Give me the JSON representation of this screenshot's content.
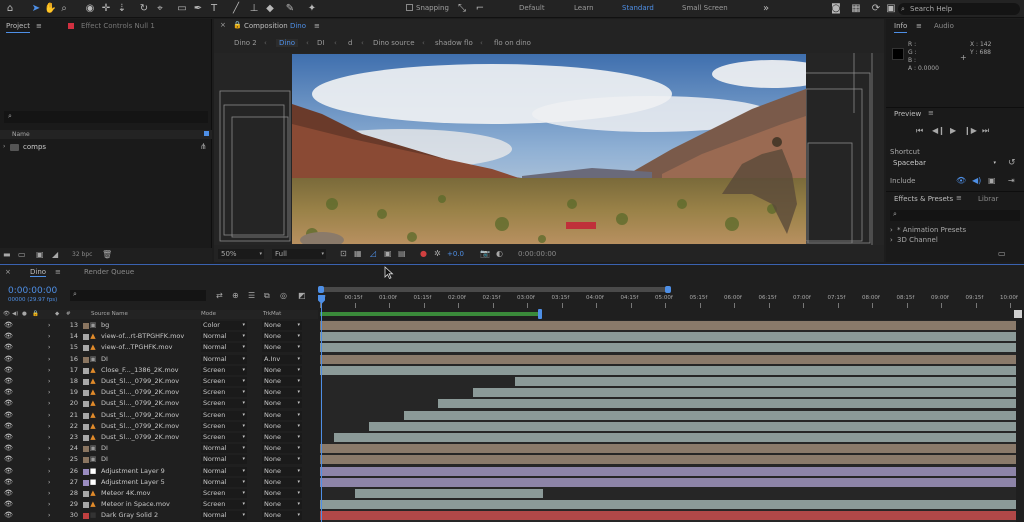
{
  "toolbar": {
    "snapping_label": "Snapping",
    "workspaces": [
      "Default",
      "Learn",
      "Standard",
      "Small Screen"
    ],
    "active_workspace": "Standard",
    "search_placeholder": "Search Help"
  },
  "project_panel": {
    "tab_project": "Project",
    "tab_effect_controls": "Effect Controls Null 1",
    "name_column": "Name",
    "folder": "comps",
    "bpc": "32 bpc"
  },
  "composition_panel": {
    "title_prefix": "Composition",
    "title_name": "Dino",
    "breadcrumbs": [
      "Dino 2",
      "Dino",
      "DI",
      "d",
      "Dino source",
      "shadow flo",
      "flo on dino"
    ],
    "zoom": "50%",
    "resolution": "Full",
    "exposure": "+0.0",
    "timecode": "0:00:00:00"
  },
  "info_panel": {
    "tab_info": "Info",
    "tab_audio": "Audio",
    "r": "R :",
    "g": "G :",
    "b": "B :",
    "a": "A : 0.0000",
    "x": "X : 142",
    "y": "Y : 688"
  },
  "preview_panel": {
    "title": "Preview",
    "shortcut_label": "Shortcut",
    "shortcut_value": "Spacebar",
    "include_label": "Include"
  },
  "effects_panel": {
    "title": "Effects & Presets",
    "tab_library": "Librar",
    "items": [
      "* Animation Presets",
      "3D Channel"
    ]
  },
  "timeline": {
    "tab_comp": "Dino",
    "tab_render_queue": "Render Queue",
    "timecode": "0:00:00:00",
    "frame_info": "00000 (29.97 fps)",
    "col_source_name": "Source Name",
    "col_mode": "Mode",
    "col_trkmat": "TrkMat",
    "ruler": [
      "0f",
      "00:15f",
      "01:00f",
      "01:15f",
      "02:00f",
      "02:15f",
      "03:00f",
      "03:15f",
      "04:00f",
      "04:15f",
      "05:00f",
      "05:15f",
      "06:00f",
      "06:15f",
      "07:00f",
      "07:15f",
      "08:00f",
      "08:15f",
      "09:00f",
      "09:15f",
      "10:00f"
    ],
    "layers": [
      {
        "num": "13",
        "name": "bg",
        "mode": "Color",
        "trkmat": "None",
        "label": "#8a7560",
        "icon": "comp",
        "bar_start": 0.0,
        "bar_end": 1.0,
        "bar_color": "#8a7a6a"
      },
      {
        "num": "14",
        "name": "view-of...rt-BTPGHFK.mov",
        "mode": "Normal",
        "trkmat": "None",
        "label": "#a8a8a8",
        "icon": "footage",
        "bar_start": 0.0,
        "bar_end": 1.0,
        "bar_color": "#8b9a98"
      },
      {
        "num": "15",
        "name": "view-of...TPGHFK.mov",
        "mode": "Normal",
        "trkmat": "None",
        "label": "#a8a8a8",
        "icon": "footage",
        "bar_start": 0.0,
        "bar_end": 1.0,
        "bar_color": "#8b9a98"
      },
      {
        "num": "16",
        "name": "DI",
        "mode": "Normal",
        "trkmat": "A.Inv",
        "label": "#8a7560",
        "icon": "comp",
        "bar_start": 0.0,
        "bar_end": 1.0,
        "bar_color": "#8a7a6a"
      },
      {
        "num": "17",
        "name": "Close_F..._1386_2K.mov",
        "mode": "Screen",
        "trkmat": "None",
        "label": "#a8a8a8",
        "icon": "footage",
        "bar_start": 0.0,
        "bar_end": 1.0,
        "bar_color": "#8b9a98"
      },
      {
        "num": "18",
        "name": "Dust_Sl..._0799_2K.mov",
        "mode": "Screen",
        "trkmat": "None",
        "label": "#a8a8a8",
        "icon": "footage",
        "bar_start": 0.28,
        "bar_end": 1.0,
        "bar_color": "#8b9a98"
      },
      {
        "num": "19",
        "name": "Dust_Sl..._0799_2K.mov",
        "mode": "Screen",
        "trkmat": "None",
        "label": "#a8a8a8",
        "icon": "footage",
        "bar_start": 0.22,
        "bar_end": 1.0,
        "bar_color": "#8b9a98"
      },
      {
        "num": "20",
        "name": "Dust_Sl..._0799_2K.mov",
        "mode": "Screen",
        "trkmat": "None",
        "label": "#a8a8a8",
        "icon": "footage",
        "bar_start": 0.17,
        "bar_end": 1.0,
        "bar_color": "#8b9a98"
      },
      {
        "num": "21",
        "name": "Dust_Sl..._0799_2K.mov",
        "mode": "Screen",
        "trkmat": "None",
        "label": "#a8a8a8",
        "icon": "footage",
        "bar_start": 0.12,
        "bar_end": 1.0,
        "bar_color": "#8b9a98"
      },
      {
        "num": "22",
        "name": "Dust_Sl..._0799_2K.mov",
        "mode": "Screen",
        "trkmat": "None",
        "label": "#a8a8a8",
        "icon": "footage",
        "bar_start": 0.07,
        "bar_end": 1.0,
        "bar_color": "#8b9a98"
      },
      {
        "num": "23",
        "name": "Dust_Sl..._0799_2K.mov",
        "mode": "Screen",
        "trkmat": "None",
        "label": "#a8a8a8",
        "icon": "footage",
        "bar_start": 0.02,
        "bar_end": 1.0,
        "bar_color": "#8b9a98"
      },
      {
        "num": "24",
        "name": "DI",
        "mode": "Normal",
        "trkmat": "None",
        "label": "#8a7560",
        "icon": "comp",
        "bar_start": 0.0,
        "bar_end": 1.0,
        "bar_color": "#8a7a6a"
      },
      {
        "num": "25",
        "name": "DI",
        "mode": "Normal",
        "trkmat": "None",
        "label": "#8a7560",
        "icon": "comp",
        "bar_start": 0.0,
        "bar_end": 1.0,
        "bar_color": "#8a7a6a"
      },
      {
        "num": "26",
        "name": "Adjustment Layer 9",
        "mode": "Normal",
        "trkmat": "None",
        "label": "#9a8cc0",
        "icon": "solid",
        "bar_start": 0.0,
        "bar_end": 1.0,
        "bar_color": "#8d84a8"
      },
      {
        "num": "27",
        "name": "Adjustment Layer 5",
        "mode": "Normal",
        "trkmat": "None",
        "label": "#9a8cc0",
        "icon": "solid",
        "bar_start": 0.0,
        "bar_end": 1.0,
        "bar_color": "#8d84a8"
      },
      {
        "num": "28",
        "name": "Meteor 4K.mov",
        "mode": "Screen",
        "trkmat": "None",
        "label": "#a8a8a8",
        "icon": "footage",
        "bar_start": 0.05,
        "bar_end": 0.32,
        "bar_color": "#8b9a98"
      },
      {
        "num": "29",
        "name": "Meteor in Space.mov",
        "mode": "Screen",
        "trkmat": "None",
        "label": "#a8a8a8",
        "icon": "footage",
        "bar_start": 0.0,
        "bar_end": 1.0,
        "bar_color": "#8b9a98"
      },
      {
        "num": "30",
        "name": "Dark Gray Solid 2",
        "mode": "Normal",
        "trkmat": "None",
        "label": "#c04040",
        "icon": "solid-dark",
        "bar_start": 0.0,
        "bar_end": 1.0,
        "bar_color": "#b04848"
      }
    ]
  }
}
